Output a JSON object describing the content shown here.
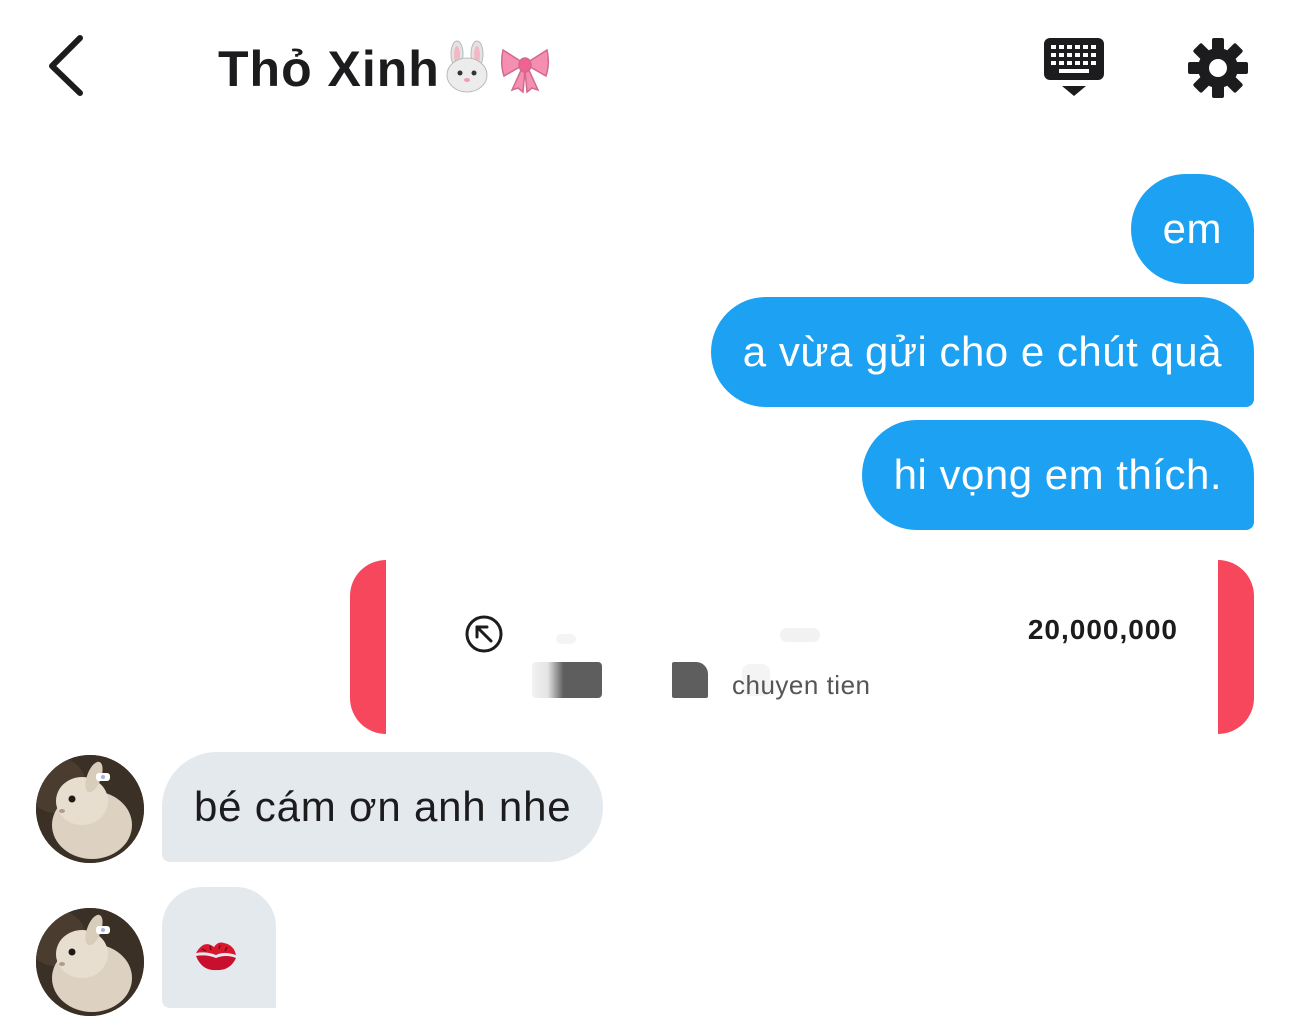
{
  "header": {
    "title": "Thỏ Xinh",
    "title_emojis": [
      "rabbit-face",
      "ribbon"
    ],
    "icons": [
      "back-chevron-icon",
      "keyboard-icon",
      "gear-icon"
    ]
  },
  "messages_out": [
    {
      "text": "em"
    },
    {
      "text": "a vừa gửi cho e chút quà"
    },
    {
      "text": "hi vọng em thích."
    }
  ],
  "transfer": {
    "icon": "arrow-up-left-icon",
    "amount": "20,000,000",
    "memo": "chuyen tien"
  },
  "messages_in": [
    {
      "text": "bé cám ơn anh nhe"
    },
    {
      "emoji": "kiss-mark"
    }
  ],
  "colors": {
    "outgoing_bubble": "#1da1f2",
    "incoming_bubble": "#e4e9ee",
    "transfer_accent": "#f7475c"
  }
}
